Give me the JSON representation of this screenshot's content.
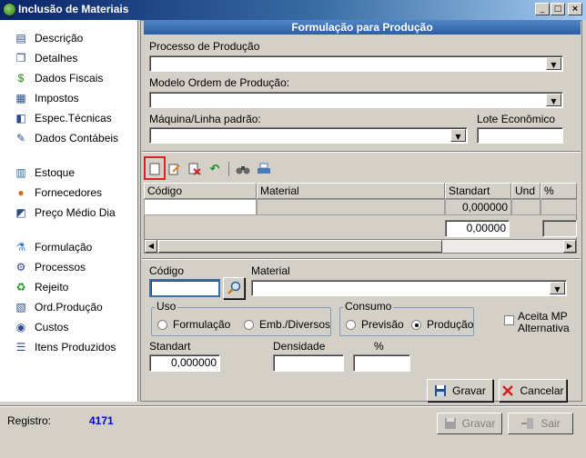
{
  "window": {
    "title": "Inclusão de Materiais",
    "minimize": "_",
    "maximize": "□",
    "close": "×"
  },
  "sidebar": {
    "items": [
      {
        "label": "Descrição",
        "icon": "form-icon"
      },
      {
        "label": "Detalhes",
        "icon": "documents-icon"
      },
      {
        "label": "Dados Fiscais",
        "icon": "dollar-icon"
      },
      {
        "label": "Impostos",
        "icon": "tax-icon"
      },
      {
        "label": "Espec.Técnicas",
        "icon": "specs-icon"
      },
      {
        "label": "Dados Contábeis",
        "icon": "ledger-icon"
      },
      {
        "label": "Estoque",
        "icon": "bar-chart-icon"
      },
      {
        "label": "Fornecedores",
        "icon": "people-icon"
      },
      {
        "label": "Preço Médio Dia",
        "icon": "price-chart-icon"
      },
      {
        "label": "Formulação",
        "icon": "flask-icon"
      },
      {
        "label": "Processos",
        "icon": "process-icon"
      },
      {
        "label": "Rejeito",
        "icon": "recycle-icon"
      },
      {
        "label": "Ord.Produção",
        "icon": "production-order-icon"
      },
      {
        "label": "Custos",
        "icon": "coins-icon"
      },
      {
        "label": "Itens Produzidos",
        "icon": "list-icon"
      }
    ]
  },
  "panel": {
    "title": "Formulação para Produção",
    "processo_label": "Processo de Produção",
    "processo_value": "",
    "modelo_label": "Modelo Ordem de Produção:",
    "modelo_value": "",
    "maquina_label": "Máquina/Linha padrão:",
    "maquina_value": "",
    "lote_label": "Lote Econômico",
    "lote_value": ""
  },
  "grid": {
    "columns": [
      "Código",
      "Material",
      "Standart",
      "Und",
      "%"
    ],
    "rows": [
      {
        "codigo": "",
        "material": "",
        "standart": "0,000000",
        "und": "",
        "pct": ""
      }
    ],
    "total": "0,00000"
  },
  "form": {
    "codigo_label": "Código",
    "codigo_value": "",
    "material_label": "Material",
    "material_value": "",
    "uso_legend": "Uso",
    "uso_options": [
      "Formulação",
      "Emb./Diversos"
    ],
    "uso_selected": "",
    "consumo_legend": "Consumo",
    "consumo_options": [
      "Previsão",
      "Produção"
    ],
    "consumo_selected": "Produção",
    "aceita_label_1": "Aceita MP",
    "aceita_label_2": "Alternativa",
    "standart_label": "Standart",
    "standart_value": "0,000000",
    "densidade_label": "Densidade",
    "densidade_value": "",
    "pct_label": "%",
    "pct_value": "",
    "gravar": "Gravar",
    "cancelar": "Cancelar"
  },
  "footer": {
    "registro_label": "Registro:",
    "registro_value": "4171",
    "gravar": "Gravar",
    "sair": "Sair"
  },
  "colors": {
    "title_start": "#0a246a",
    "header_blue": "#2d5fa3",
    "registro_blue": "#0000cc",
    "highlight_red": "#e02020"
  }
}
